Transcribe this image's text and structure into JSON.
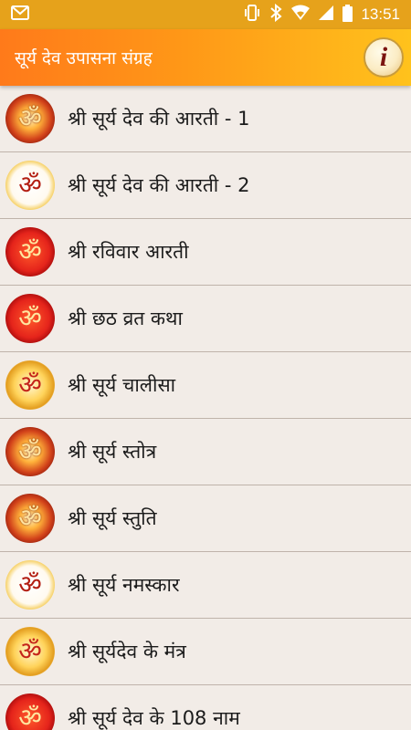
{
  "status_bar": {
    "time": "13:51",
    "icons": [
      "gmail-icon",
      "vibrate-icon",
      "bluetooth-icon",
      "wifi-icon",
      "signal-icon",
      "battery-icon"
    ]
  },
  "app_bar": {
    "title": "सूर्य देव उपासना संग्रह",
    "info_label": "i"
  },
  "list": {
    "items": [
      {
        "label": "श्री सूर्य देव की आरती - 1",
        "icon": "om-icon",
        "style": "fiery",
        "glyph": "ॐ"
      },
      {
        "label": "श्री सूर्य देव की आरती - 2",
        "icon": "om-icon",
        "style": "white",
        "glyph": "ॐ"
      },
      {
        "label": "श्री रविवार आरती",
        "icon": "om-icon",
        "style": "red",
        "glyph": "ॐ"
      },
      {
        "label": "श्री छठ व्रत कथा",
        "icon": "om-icon",
        "style": "red",
        "glyph": "ॐ"
      },
      {
        "label": "श्री सूर्य चालीसा",
        "icon": "om-icon",
        "style": "gold",
        "glyph": "ॐ"
      },
      {
        "label": "श्री सूर्य स्तोत्र",
        "icon": "om-icon",
        "style": "fiery",
        "glyph": "ॐ"
      },
      {
        "label": "श्री सूर्य स्तुति",
        "icon": "om-icon",
        "style": "fiery",
        "glyph": "ॐ"
      },
      {
        "label": "श्री सूर्य नमस्कार",
        "icon": "om-icon",
        "style": "white",
        "glyph": "ॐ"
      },
      {
        "label": "श्री सूर्यदेव के मंत्र",
        "icon": "om-icon",
        "style": "gold",
        "glyph": "ॐ"
      },
      {
        "label": "श्री सूर्य देव के 108 नाम",
        "icon": "om-icon",
        "style": "red",
        "glyph": "ॐ"
      }
    ]
  },
  "colors": {
    "status_bar": "#e6a21b",
    "app_bar_start": "#ff7a1a",
    "app_bar_end": "#ffc21c",
    "list_bg": "#f2ece7",
    "divider": "#bfb3aa"
  }
}
